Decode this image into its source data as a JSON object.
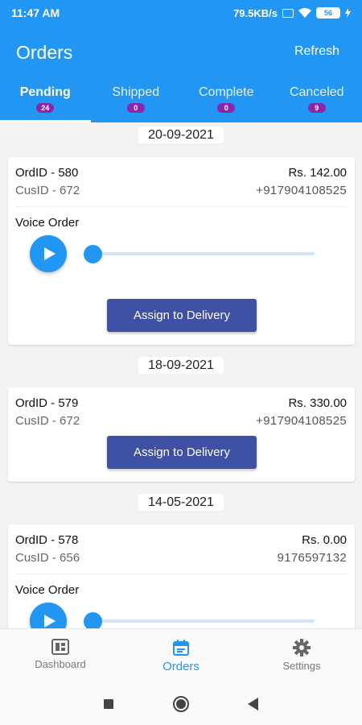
{
  "status": {
    "time": "11:47 AM",
    "speed": "79.5KB/s",
    "battery": "56"
  },
  "appbar": {
    "title": "Orders",
    "refresh_label": "Refresh"
  },
  "tabs": [
    {
      "label": "Pending",
      "count": "24"
    },
    {
      "label": "Shipped",
      "count": "0"
    },
    {
      "label": "Complete",
      "count": "0"
    },
    {
      "label": "Canceled",
      "count": "9"
    }
  ],
  "orders": [
    {
      "date": "20-09-2021",
      "ord_id": "OrdID - 580",
      "cus_id": "CusID - 672",
      "amount": "Rs. 142.00",
      "phone": "+917904108525",
      "voice_label": "Voice Order",
      "assign_label": "Assign to Delivery"
    },
    {
      "date": "18-09-2021",
      "ord_id": "OrdID - 579",
      "cus_id": "CusID - 672",
      "amount": "Rs. 330.00",
      "phone": "+917904108525",
      "assign_label": "Assign to Delivery"
    },
    {
      "date": "14-05-2021",
      "ord_id": "OrdID - 578",
      "cus_id": "CusID - 656",
      "amount": "Rs. 0.00",
      "phone": "9176597132",
      "voice_label": "Voice Order"
    }
  ],
  "bottom_nav": [
    {
      "label": "Dashboard",
      "icon": "dashboard-icon"
    },
    {
      "label": "Orders",
      "icon": "calendar-icon"
    },
    {
      "label": "Settings",
      "icon": "gear-icon"
    }
  ],
  "colors": {
    "primary": "#2196f3",
    "button": "#3f51a5",
    "badge": "#8e24aa"
  }
}
